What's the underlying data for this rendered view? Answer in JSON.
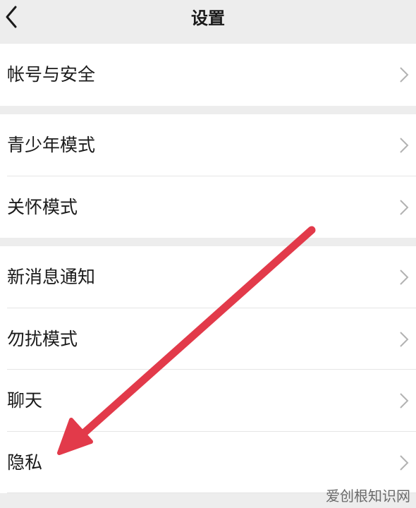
{
  "header": {
    "title": "设置",
    "back_icon": "chevron-left-icon"
  },
  "groups": [
    {
      "items": [
        {
          "label": "帐号与安全"
        }
      ]
    },
    {
      "items": [
        {
          "label": "青少年模式"
        },
        {
          "label": "关怀模式"
        }
      ]
    },
    {
      "items": [
        {
          "label": "新消息通知"
        },
        {
          "label": "勿扰模式"
        },
        {
          "label": "聊天"
        },
        {
          "label": "隐私"
        }
      ]
    }
  ],
  "row_icon": "chevron-right-icon",
  "annotation": {
    "icon": "red-arrow-icon",
    "color": "#e23a4a"
  },
  "watermark": "爱创根知识网",
  "colors": {
    "background": "#ededed",
    "row": "#ffffff",
    "chevron": "#b2b2b2"
  }
}
